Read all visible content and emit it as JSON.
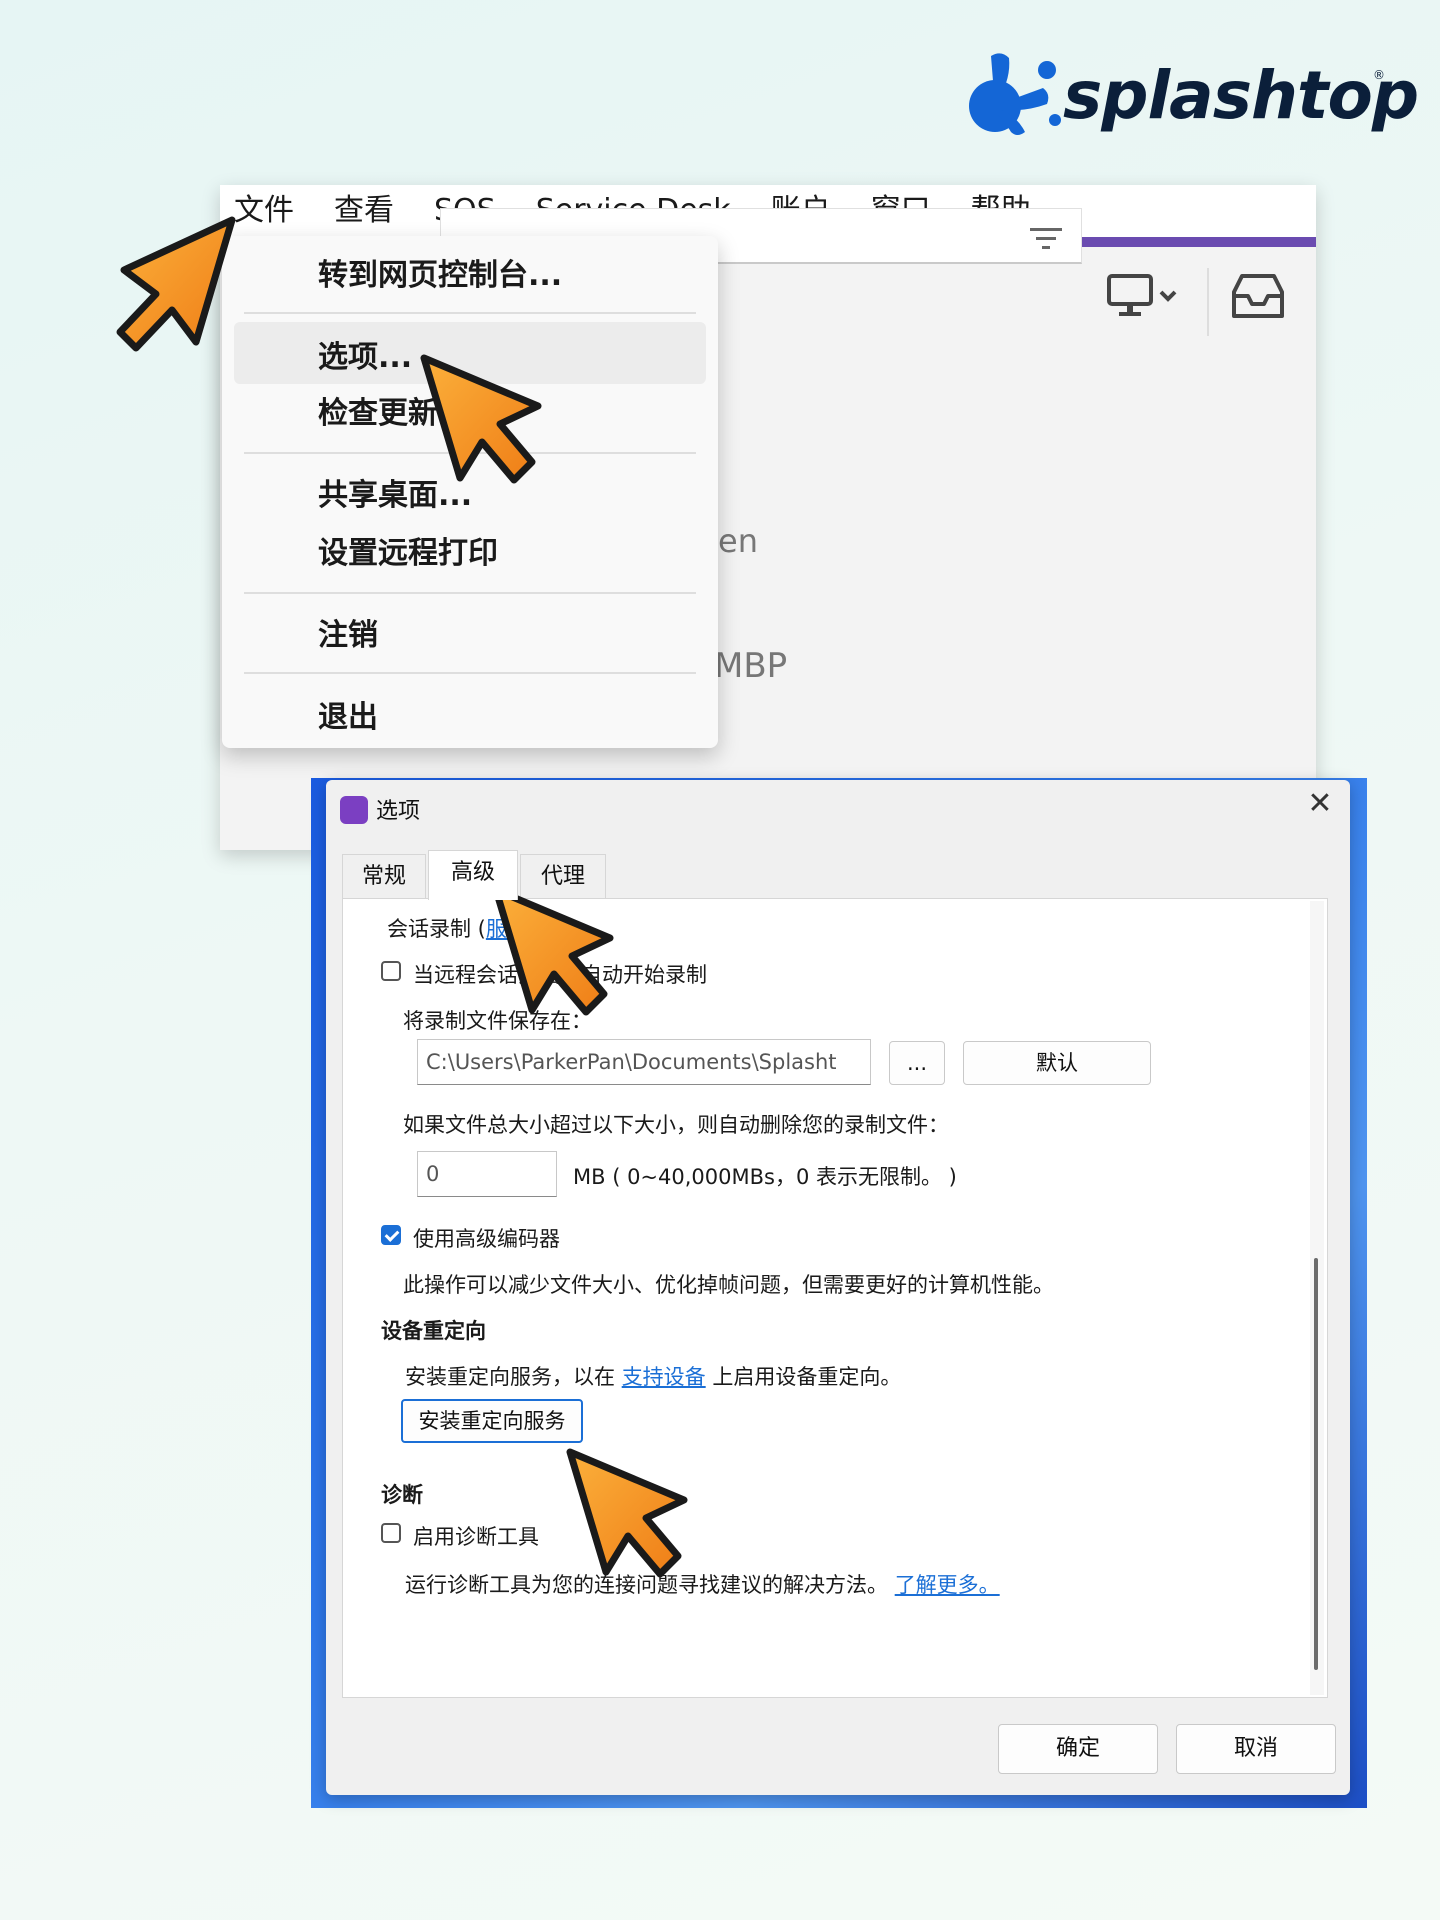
{
  "brand": {
    "name": "splashtop",
    "reg": "®",
    "colors": {
      "navy": "#0b1f3a",
      "blue": "#1466d6"
    }
  },
  "app": {
    "menubar": [
      "文件",
      "查看",
      "SOS",
      "Service Desk",
      "账户",
      "窗口",
      "帮助"
    ],
    "accent_color": "#6a4bb0",
    "background_text": [
      "en",
      "MBP"
    ],
    "icons": [
      "filter-icon",
      "monitor-icon",
      "chevron-down-icon",
      "inbox-icon"
    ]
  },
  "file_menu": {
    "items": [
      {
        "label": "转到网页控制台..."
      },
      {
        "label": "选项..."
      },
      {
        "label": "检查更新"
      },
      {
        "label": "共享桌面..."
      },
      {
        "label": "设置远程打印"
      },
      {
        "label": "注销"
      },
      {
        "label": "退出"
      }
    ],
    "highlighted": "选项..."
  },
  "options_dialog": {
    "title": "选项",
    "tabs": [
      "常规",
      "高级",
      "代理"
    ],
    "active_tab": "高级",
    "session_recording": {
      "heading_prefix": "会话录制 (",
      "heading_link": "服务",
      "heading_suffix": ")",
      "auto_record_label": "当远程会话开始时自动开始录制",
      "auto_record_checked": false,
      "save_to_label": "将录制文件保存在：",
      "save_path": "C:\\Users\\ParkerPan\\Documents\\Splasht",
      "browse_label": "...",
      "default_label": "默认",
      "size_limit_label": "如果文件总大小超过以下大小，则自动删除您的录制文件：",
      "size_value": "0",
      "size_unit_label": "MB ( 0~40,000MBs，0 表示无限制。 )"
    },
    "advanced_codec": {
      "label": "使用高级编码器",
      "checked": true,
      "description": "此操作可以减少文件大小、优化掉帧问题，但需要更好的计算机性能。"
    },
    "device_redirection": {
      "heading": "设备重定向",
      "desc_prefix": "安装重定向服务，以在",
      "desc_link": "支持设备",
      "desc_suffix": "上启用设备重定向。",
      "install_button": "安装重定向服务"
    },
    "diagnostics": {
      "heading": "诊断",
      "enable_label": "启用诊断工具",
      "enable_checked": false,
      "desc": "运行诊断工具为您的连接问题寻找建议的解决方法。",
      "learn_more": "了解更多。"
    },
    "ok_label": "确定",
    "cancel_label": "取消"
  },
  "cursor_color": "#f39a1e"
}
